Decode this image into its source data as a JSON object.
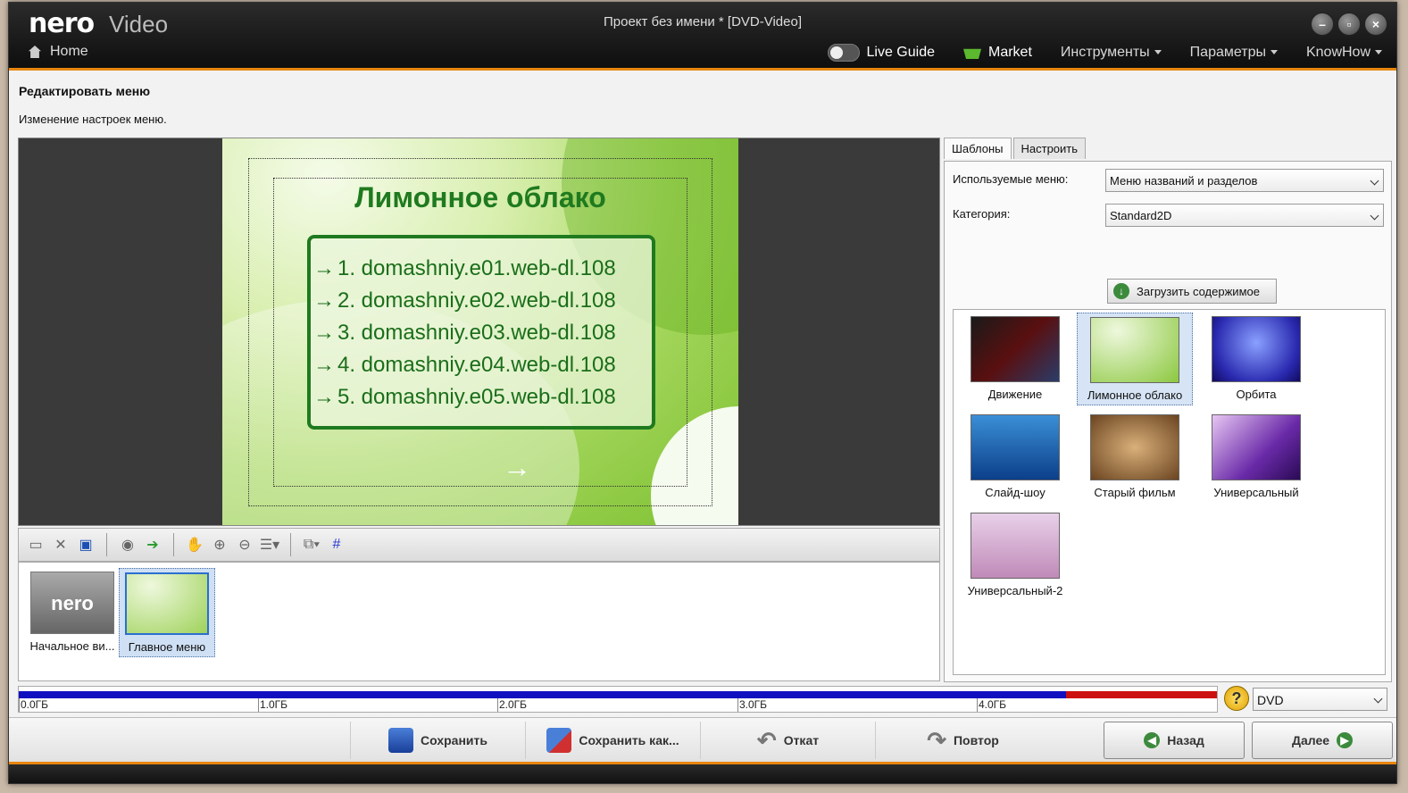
{
  "window": {
    "logo": "nero",
    "logo_product": "Video",
    "title": "Проект без имени * [DVD-Video]",
    "home": "Home",
    "live_guide": "Live Guide",
    "market": "Market",
    "menus": [
      "Инструменты",
      "Параметры",
      "KnowHow"
    ]
  },
  "page": {
    "title": "Редактировать меню",
    "subtitle": "Изменение настроек меню."
  },
  "preview": {
    "menu_title": "Лимонное облако",
    "items": [
      "1. domashniy.e01.web-dl.108",
      "2. domashniy.e02.web-dl.108",
      "3. domashniy.e03.web-dl.108",
      "4. domashniy.e04.web-dl.108",
      "5. domashniy.e05.web-dl.108"
    ]
  },
  "thumbnails": [
    {
      "label": "Начальное ви...",
      "selected": false
    },
    {
      "label": "Главное меню",
      "selected": true
    }
  ],
  "right_panel": {
    "tabs": [
      "Шаблоны",
      "Настроить"
    ],
    "used_menu_label": "Используемые меню:",
    "used_menu_value": "Меню названий и разделов",
    "category_label": "Категория:",
    "category_value": "Standard2D",
    "load_button": "Загрузить содержимое",
    "templates": [
      {
        "label": "Движение",
        "selected": false
      },
      {
        "label": "Лимонное облако",
        "selected": true
      },
      {
        "label": "Орбита",
        "selected": false
      },
      {
        "label": "Слайд-шоу",
        "selected": false
      },
      {
        "label": "Старый фильм",
        "selected": false
      },
      {
        "label": "Универсальный",
        "selected": false
      },
      {
        "label": "Универсальный-2",
        "selected": false
      }
    ]
  },
  "disc": {
    "ticks": [
      "0.0ГБ",
      "1.0ГБ",
      "2.0ГБ",
      "3.0ГБ",
      "4.0ГБ"
    ],
    "used_fraction": 0.874,
    "type": "DVD"
  },
  "actions": {
    "save": "Сохранить",
    "save_as": "Сохранить как...",
    "undo": "Откат",
    "redo": "Повтор",
    "back": "Назад",
    "next": "Далее"
  }
}
